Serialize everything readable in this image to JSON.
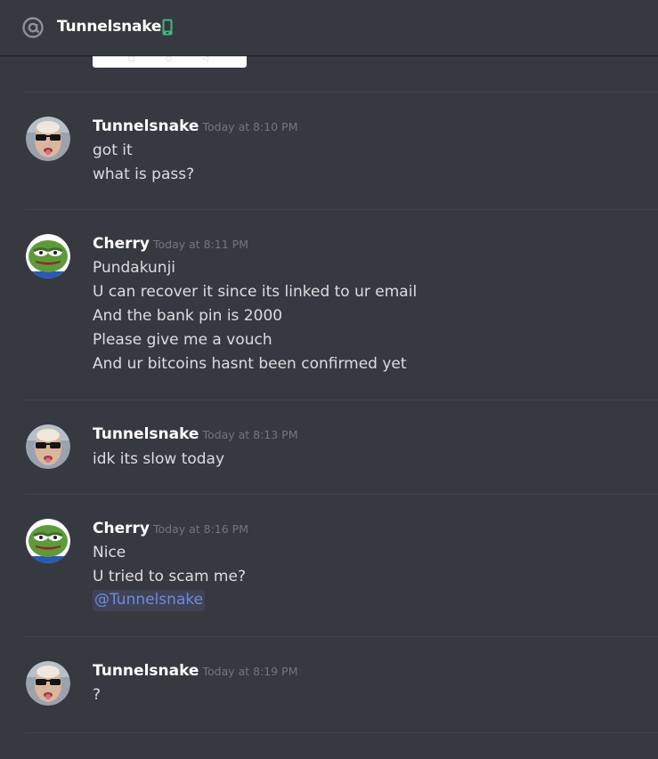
{
  "header": {
    "at_icon": "at-sign-icon",
    "title": "Tunnelsnake",
    "status_icon": "mobile-phone-icon",
    "status_color": "#43b581"
  },
  "image_embed": {
    "icon": "image-attachment"
  },
  "messages": [
    {
      "author": "Tunnelsnake",
      "avatar": "tunnelsnake-avatar",
      "timestamp": "Today at 8:10 PM",
      "lines": [
        "got it",
        "what is pass?"
      ]
    },
    {
      "author": "Cherry",
      "avatar": "pepe-frog-avatar",
      "timestamp": "Today at 8:11 PM",
      "lines": [
        "Pundakunji",
        "U can recover it since its linked to ur email",
        "And the bank pin is 2000",
        "Please give me a vouch",
        "And ur bitcoins hasnt been confirmed yet"
      ]
    },
    {
      "author": "Tunnelsnake",
      "avatar": "tunnelsnake-avatar",
      "timestamp": "Today at 8:13 PM",
      "lines": [
        "idk its slow today"
      ]
    },
    {
      "author": "Cherry",
      "avatar": "pepe-frog-avatar",
      "timestamp": "Today at 8:16 PM",
      "lines": [
        "Nice",
        "U tried to scam me?"
      ],
      "mention": "@Tunnelsnake"
    },
    {
      "author": "Tunnelsnake",
      "avatar": "tunnelsnake-avatar",
      "timestamp": "Today at 8:19 PM",
      "lines": [
        "?"
      ]
    }
  ],
  "colors": {
    "background": "#36393f",
    "text": "#dcddde",
    "author": "#ffffff",
    "timestamp": "#72767d",
    "mention": "#7289da",
    "divider": "#41444a"
  }
}
